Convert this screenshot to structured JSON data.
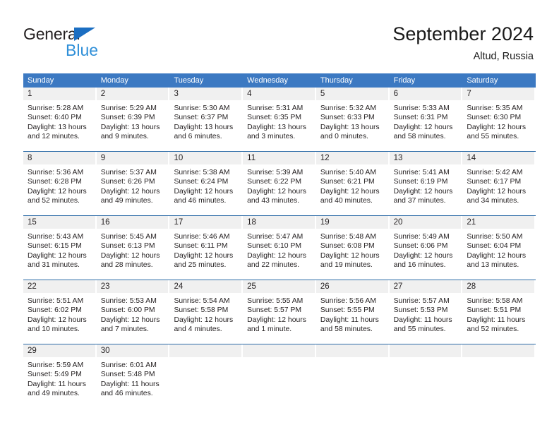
{
  "brand": {
    "name_part1": "General",
    "name_part2": "Blue",
    "triangle_icon": "triangle-icon",
    "color_dark": "#231f20",
    "color_blue": "#2f8fd8"
  },
  "header": {
    "title": "September 2024",
    "subtitle": "Altud, Russia"
  },
  "theme": {
    "header_blue": "#3c79c2",
    "rule_blue": "#2e6ca8",
    "date_band_gray": "#f0f0f0",
    "text": "#231f20"
  },
  "weekdays": [
    "Sunday",
    "Monday",
    "Tuesday",
    "Wednesday",
    "Thursday",
    "Friday",
    "Saturday"
  ],
  "weeks": [
    [
      {
        "day": "1",
        "sunrise": "Sunrise: 5:28 AM",
        "sunset": "Sunset: 6:40 PM",
        "daylight_1": "Daylight: 13 hours",
        "daylight_2": "and 12 minutes."
      },
      {
        "day": "2",
        "sunrise": "Sunrise: 5:29 AM",
        "sunset": "Sunset: 6:39 PM",
        "daylight_1": "Daylight: 13 hours",
        "daylight_2": "and 9 minutes."
      },
      {
        "day": "3",
        "sunrise": "Sunrise: 5:30 AM",
        "sunset": "Sunset: 6:37 PM",
        "daylight_1": "Daylight: 13 hours",
        "daylight_2": "and 6 minutes."
      },
      {
        "day": "4",
        "sunrise": "Sunrise: 5:31 AM",
        "sunset": "Sunset: 6:35 PM",
        "daylight_1": "Daylight: 13 hours",
        "daylight_2": "and 3 minutes."
      },
      {
        "day": "5",
        "sunrise": "Sunrise: 5:32 AM",
        "sunset": "Sunset: 6:33 PM",
        "daylight_1": "Daylight: 13 hours",
        "daylight_2": "and 0 minutes."
      },
      {
        "day": "6",
        "sunrise": "Sunrise: 5:33 AM",
        "sunset": "Sunset: 6:31 PM",
        "daylight_1": "Daylight: 12 hours",
        "daylight_2": "and 58 minutes."
      },
      {
        "day": "7",
        "sunrise": "Sunrise: 5:35 AM",
        "sunset": "Sunset: 6:30 PM",
        "daylight_1": "Daylight: 12 hours",
        "daylight_2": "and 55 minutes."
      }
    ],
    [
      {
        "day": "8",
        "sunrise": "Sunrise: 5:36 AM",
        "sunset": "Sunset: 6:28 PM",
        "daylight_1": "Daylight: 12 hours",
        "daylight_2": "and 52 minutes."
      },
      {
        "day": "9",
        "sunrise": "Sunrise: 5:37 AM",
        "sunset": "Sunset: 6:26 PM",
        "daylight_1": "Daylight: 12 hours",
        "daylight_2": "and 49 minutes."
      },
      {
        "day": "10",
        "sunrise": "Sunrise: 5:38 AM",
        "sunset": "Sunset: 6:24 PM",
        "daylight_1": "Daylight: 12 hours",
        "daylight_2": "and 46 minutes."
      },
      {
        "day": "11",
        "sunrise": "Sunrise: 5:39 AM",
        "sunset": "Sunset: 6:22 PM",
        "daylight_1": "Daylight: 12 hours",
        "daylight_2": "and 43 minutes."
      },
      {
        "day": "12",
        "sunrise": "Sunrise: 5:40 AM",
        "sunset": "Sunset: 6:21 PM",
        "daylight_1": "Daylight: 12 hours",
        "daylight_2": "and 40 minutes."
      },
      {
        "day": "13",
        "sunrise": "Sunrise: 5:41 AM",
        "sunset": "Sunset: 6:19 PM",
        "daylight_1": "Daylight: 12 hours",
        "daylight_2": "and 37 minutes."
      },
      {
        "day": "14",
        "sunrise": "Sunrise: 5:42 AM",
        "sunset": "Sunset: 6:17 PM",
        "daylight_1": "Daylight: 12 hours",
        "daylight_2": "and 34 minutes."
      }
    ],
    [
      {
        "day": "15",
        "sunrise": "Sunrise: 5:43 AM",
        "sunset": "Sunset: 6:15 PM",
        "daylight_1": "Daylight: 12 hours",
        "daylight_2": "and 31 minutes."
      },
      {
        "day": "16",
        "sunrise": "Sunrise: 5:45 AM",
        "sunset": "Sunset: 6:13 PM",
        "daylight_1": "Daylight: 12 hours",
        "daylight_2": "and 28 minutes."
      },
      {
        "day": "17",
        "sunrise": "Sunrise: 5:46 AM",
        "sunset": "Sunset: 6:11 PM",
        "daylight_1": "Daylight: 12 hours",
        "daylight_2": "and 25 minutes."
      },
      {
        "day": "18",
        "sunrise": "Sunrise: 5:47 AM",
        "sunset": "Sunset: 6:10 PM",
        "daylight_1": "Daylight: 12 hours",
        "daylight_2": "and 22 minutes."
      },
      {
        "day": "19",
        "sunrise": "Sunrise: 5:48 AM",
        "sunset": "Sunset: 6:08 PM",
        "daylight_1": "Daylight: 12 hours",
        "daylight_2": "and 19 minutes."
      },
      {
        "day": "20",
        "sunrise": "Sunrise: 5:49 AM",
        "sunset": "Sunset: 6:06 PM",
        "daylight_1": "Daylight: 12 hours",
        "daylight_2": "and 16 minutes."
      },
      {
        "day": "21",
        "sunrise": "Sunrise: 5:50 AM",
        "sunset": "Sunset: 6:04 PM",
        "daylight_1": "Daylight: 12 hours",
        "daylight_2": "and 13 minutes."
      }
    ],
    [
      {
        "day": "22",
        "sunrise": "Sunrise: 5:51 AM",
        "sunset": "Sunset: 6:02 PM",
        "daylight_1": "Daylight: 12 hours",
        "daylight_2": "and 10 minutes."
      },
      {
        "day": "23",
        "sunrise": "Sunrise: 5:53 AM",
        "sunset": "Sunset: 6:00 PM",
        "daylight_1": "Daylight: 12 hours",
        "daylight_2": "and 7 minutes."
      },
      {
        "day": "24",
        "sunrise": "Sunrise: 5:54 AM",
        "sunset": "Sunset: 5:58 PM",
        "daylight_1": "Daylight: 12 hours",
        "daylight_2": "and 4 minutes."
      },
      {
        "day": "25",
        "sunrise": "Sunrise: 5:55 AM",
        "sunset": "Sunset: 5:57 PM",
        "daylight_1": "Daylight: 12 hours",
        "daylight_2": "and 1 minute."
      },
      {
        "day": "26",
        "sunrise": "Sunrise: 5:56 AM",
        "sunset": "Sunset: 5:55 PM",
        "daylight_1": "Daylight: 11 hours",
        "daylight_2": "and 58 minutes."
      },
      {
        "day": "27",
        "sunrise": "Sunrise: 5:57 AM",
        "sunset": "Sunset: 5:53 PM",
        "daylight_1": "Daylight: 11 hours",
        "daylight_2": "and 55 minutes."
      },
      {
        "day": "28",
        "sunrise": "Sunrise: 5:58 AM",
        "sunset": "Sunset: 5:51 PM",
        "daylight_1": "Daylight: 11 hours",
        "daylight_2": "and 52 minutes."
      }
    ],
    [
      {
        "day": "29",
        "sunrise": "Sunrise: 5:59 AM",
        "sunset": "Sunset: 5:49 PM",
        "daylight_1": "Daylight: 11 hours",
        "daylight_2": "and 49 minutes."
      },
      {
        "day": "30",
        "sunrise": "Sunrise: 6:01 AM",
        "sunset": "Sunset: 5:48 PM",
        "daylight_1": "Daylight: 11 hours",
        "daylight_2": "and 46 minutes."
      },
      {
        "day": "",
        "sunrise": "",
        "sunset": "",
        "daylight_1": "",
        "daylight_2": ""
      },
      {
        "day": "",
        "sunrise": "",
        "sunset": "",
        "daylight_1": "",
        "daylight_2": ""
      },
      {
        "day": "",
        "sunrise": "",
        "sunset": "",
        "daylight_1": "",
        "daylight_2": ""
      },
      {
        "day": "",
        "sunrise": "",
        "sunset": "",
        "daylight_1": "",
        "daylight_2": ""
      },
      {
        "day": "",
        "sunrise": "",
        "sunset": "",
        "daylight_1": "",
        "daylight_2": ""
      }
    ]
  ]
}
